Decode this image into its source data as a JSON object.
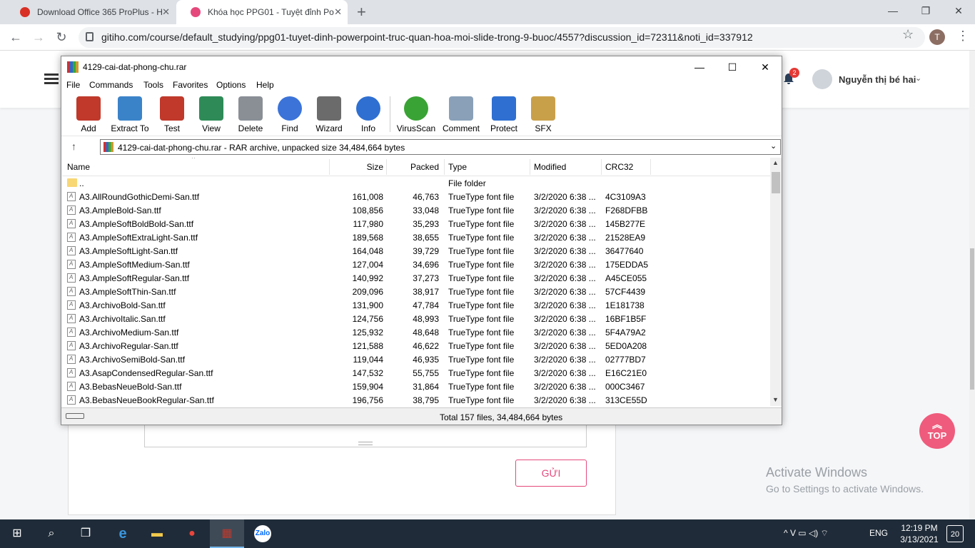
{
  "browser": {
    "tabs": [
      {
        "title": "Download Office 365 ProPlus - H",
        "favicon_color": "#d93025"
      },
      {
        "title": "Khóa học PPG01 - Tuyệt đỉnh Po",
        "favicon_color": "#e5497c"
      }
    ],
    "new_tab_glyph": "+",
    "window_controls": {
      "minimize": "—",
      "restore": "❐",
      "close": "✕"
    },
    "nav": {
      "back": "←",
      "forward": "→",
      "reload": "↻"
    },
    "url": "gitiho.com/course/default_studying/ppg01-tuyet-dinh-powerpoint-truc-quan-hoa-moi-slide-trong-9-buoc/4557?discussion_id=72311&noti_id=337912",
    "star": "☆",
    "profile_initial": "T",
    "menu": "⋮"
  },
  "site": {
    "notification_count": "2",
    "user_name": "Nguyễn thị bé hai",
    "send_button": "GỬI",
    "top_button": "TOP",
    "activate_title": "Activate Windows",
    "activate_subtitle": "Go to Settings to activate Windows."
  },
  "winrar": {
    "title": "4129-cai-dat-phong-chu.rar",
    "controls": {
      "minimize": "—",
      "maximize": "☐",
      "close": "✕"
    },
    "menu": [
      "File",
      "Commands",
      "Tools",
      "Favorites",
      "Options",
      "Help"
    ],
    "tools": [
      {
        "label": "Add",
        "icon": "add-icon",
        "color": "#c0392b"
      },
      {
        "label": "Extract To",
        "icon": "extract-folder-icon",
        "color": "#3b83c9"
      },
      {
        "label": "Test",
        "icon": "test-clipboard-icon",
        "color": "#c0392b"
      },
      {
        "label": "View",
        "icon": "view-book-icon",
        "color": "#2e8b57"
      },
      {
        "label": "Delete",
        "icon": "trash-icon",
        "color": "#8a8f96"
      },
      {
        "label": "Find",
        "icon": "magnifier-icon",
        "color": "#3b73d9"
      },
      {
        "label": "Wizard",
        "icon": "wand-icon",
        "color": "#6b6b6b"
      },
      {
        "label": "Info",
        "icon": "info-icon",
        "color": "#2f6fd1"
      },
      {
        "label": "VirusScan",
        "icon": "virus-icon",
        "color": "#3aa335"
      },
      {
        "label": "Comment",
        "icon": "comment-icon",
        "color": "#8aa0b8"
      },
      {
        "label": "Protect",
        "icon": "shield-icon",
        "color": "#2f6fd1"
      },
      {
        "label": "SFX",
        "icon": "sfx-box-icon",
        "color": "#c9a04a"
      }
    ],
    "up_glyph": "↑",
    "path": "4129-cai-dat-phong-chu.rar - RAR archive, unpacked size 34,484,664 bytes",
    "columns": {
      "name": "Name",
      "size": "Size",
      "packed": "Packed",
      "type": "Type",
      "modified": "Modified",
      "crc": "CRC32"
    },
    "parent_row": {
      "name": "..",
      "type": "File folder"
    },
    "files": [
      {
        "name": "A3.AllRoundGothicDemi-San.ttf",
        "size": "161,008",
        "packed": "46,763",
        "type": "TrueType font file",
        "modified": "3/2/2020 6:38 ...",
        "crc": "4C3109A3"
      },
      {
        "name": "A3.AmpleBold-San.ttf",
        "size": "108,856",
        "packed": "33,048",
        "type": "TrueType font file",
        "modified": "3/2/2020 6:38 ...",
        "crc": "F268DFBB"
      },
      {
        "name": "A3.AmpleSoftBoldBold-San.ttf",
        "size": "117,980",
        "packed": "35,293",
        "type": "TrueType font file",
        "modified": "3/2/2020 6:38 ...",
        "crc": "145B277E"
      },
      {
        "name": "A3.AmpleSoftExtraLight-San.ttf",
        "size": "189,568",
        "packed": "38,655",
        "type": "TrueType font file",
        "modified": "3/2/2020 6:38 ...",
        "crc": "21528EA9"
      },
      {
        "name": "A3.AmpleSoftLight-San.ttf",
        "size": "164,048",
        "packed": "39,729",
        "type": "TrueType font file",
        "modified": "3/2/2020 6:38 ...",
        "crc": "36477640"
      },
      {
        "name": "A3.AmpleSoftMedium-San.ttf",
        "size": "127,004",
        "packed": "34,696",
        "type": "TrueType font file",
        "modified": "3/2/2020 6:38 ...",
        "crc": "175EDDA5"
      },
      {
        "name": "A3.AmpleSoftRegular-San.ttf",
        "size": "140,992",
        "packed": "37,273",
        "type": "TrueType font file",
        "modified": "3/2/2020 6:38 ...",
        "crc": "A45CE055"
      },
      {
        "name": "A3.AmpleSoftThin-San.ttf",
        "size": "209,096",
        "packed": "38,917",
        "type": "TrueType font file",
        "modified": "3/2/2020 6:38 ...",
        "crc": "57CF4439"
      },
      {
        "name": "A3.ArchivoBold-San.ttf",
        "size": "131,900",
        "packed": "47,784",
        "type": "TrueType font file",
        "modified": "3/2/2020 6:38 ...",
        "crc": "1E181738"
      },
      {
        "name": "A3.ArchivoItalic.San.ttf",
        "size": "124,756",
        "packed": "48,993",
        "type": "TrueType font file",
        "modified": "3/2/2020 6:38 ...",
        "crc": "16BF1B5F"
      },
      {
        "name": "A3.ArchivoMedium-San.ttf",
        "size": "125,932",
        "packed": "48,648",
        "type": "TrueType font file",
        "modified": "3/2/2020 6:38 ...",
        "crc": "5F4A79A2"
      },
      {
        "name": "A3.ArchivoRegular-San.ttf",
        "size": "121,588",
        "packed": "46,622",
        "type": "TrueType font file",
        "modified": "3/2/2020 6:38 ...",
        "crc": "5ED0A208"
      },
      {
        "name": "A3.ArchivoSemiBold-San.ttf",
        "size": "119,044",
        "packed": "46,935",
        "type": "TrueType font file",
        "modified": "3/2/2020 6:38 ...",
        "crc": "02777BD7"
      },
      {
        "name": "A3.AsapCondensedRegular-San.ttf",
        "size": "147,532",
        "packed": "55,755",
        "type": "TrueType font file",
        "modified": "3/2/2020 6:38 ...",
        "crc": "E16C21E0"
      },
      {
        "name": "A3.BebasNeueBold-San.ttf",
        "size": "159,904",
        "packed": "31,864",
        "type": "TrueType font file",
        "modified": "3/2/2020 6:38 ...",
        "crc": "000C3467"
      },
      {
        "name": "A3.BebasNeueBookRegular-San.ttf",
        "size": "196,756",
        "packed": "38,795",
        "type": "TrueType font file",
        "modified": "3/2/2020 6:38 ...",
        "crc": "313CE55D"
      }
    ],
    "status": "Total 157 files, 34,484,664 bytes"
  },
  "taskbar": {
    "start": "⊞",
    "search": "⌕",
    "task_view": "❒",
    "apps": [
      {
        "name": "edge",
        "icon": "edge-icon",
        "glyph": "e",
        "color": "#3a96dd"
      },
      {
        "name": "explorer",
        "icon": "folder-icon",
        "glyph": "▬",
        "color": "#f2c94c"
      },
      {
        "name": "chrome",
        "icon": "chrome-icon",
        "glyph": "●",
        "color": "#e8453c"
      },
      {
        "name": "winrar",
        "icon": "winrar-icon",
        "glyph": "▦",
        "color": "#c0392b"
      },
      {
        "name": "zalo",
        "icon": "zalo-icon",
        "glyph": "Zalo",
        "color": "#0068ff"
      }
    ],
    "tray_glyphs": "^  V  ▭  ◁)  ⌔",
    "language": "ENG",
    "time": "12:19 PM",
    "date": "3/13/2021",
    "notifications": "20"
  }
}
